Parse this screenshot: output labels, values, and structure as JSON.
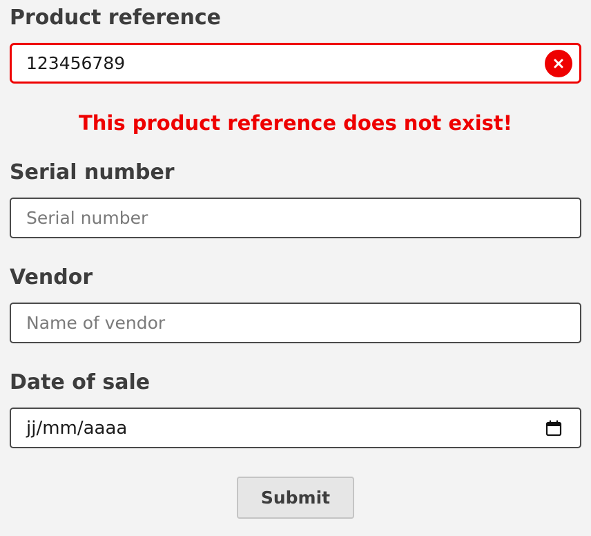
{
  "form": {
    "product_reference": {
      "label": "Product reference",
      "value": "123456789",
      "clear_icon": "close-x-icon",
      "error": "This product reference does not exist!"
    },
    "serial_number": {
      "label": "Serial number",
      "placeholder": "Serial number"
    },
    "vendor": {
      "label": "Vendor",
      "placeholder": "Name of vendor"
    },
    "date_of_sale": {
      "label": "Date of sale",
      "value": "jj/mm/aaaa",
      "icon": "calendar-icon"
    },
    "submit_label": "Submit"
  },
  "colors": {
    "error": "#ee0000",
    "label": "#3d3d3d",
    "background": "#f3f3f3"
  }
}
